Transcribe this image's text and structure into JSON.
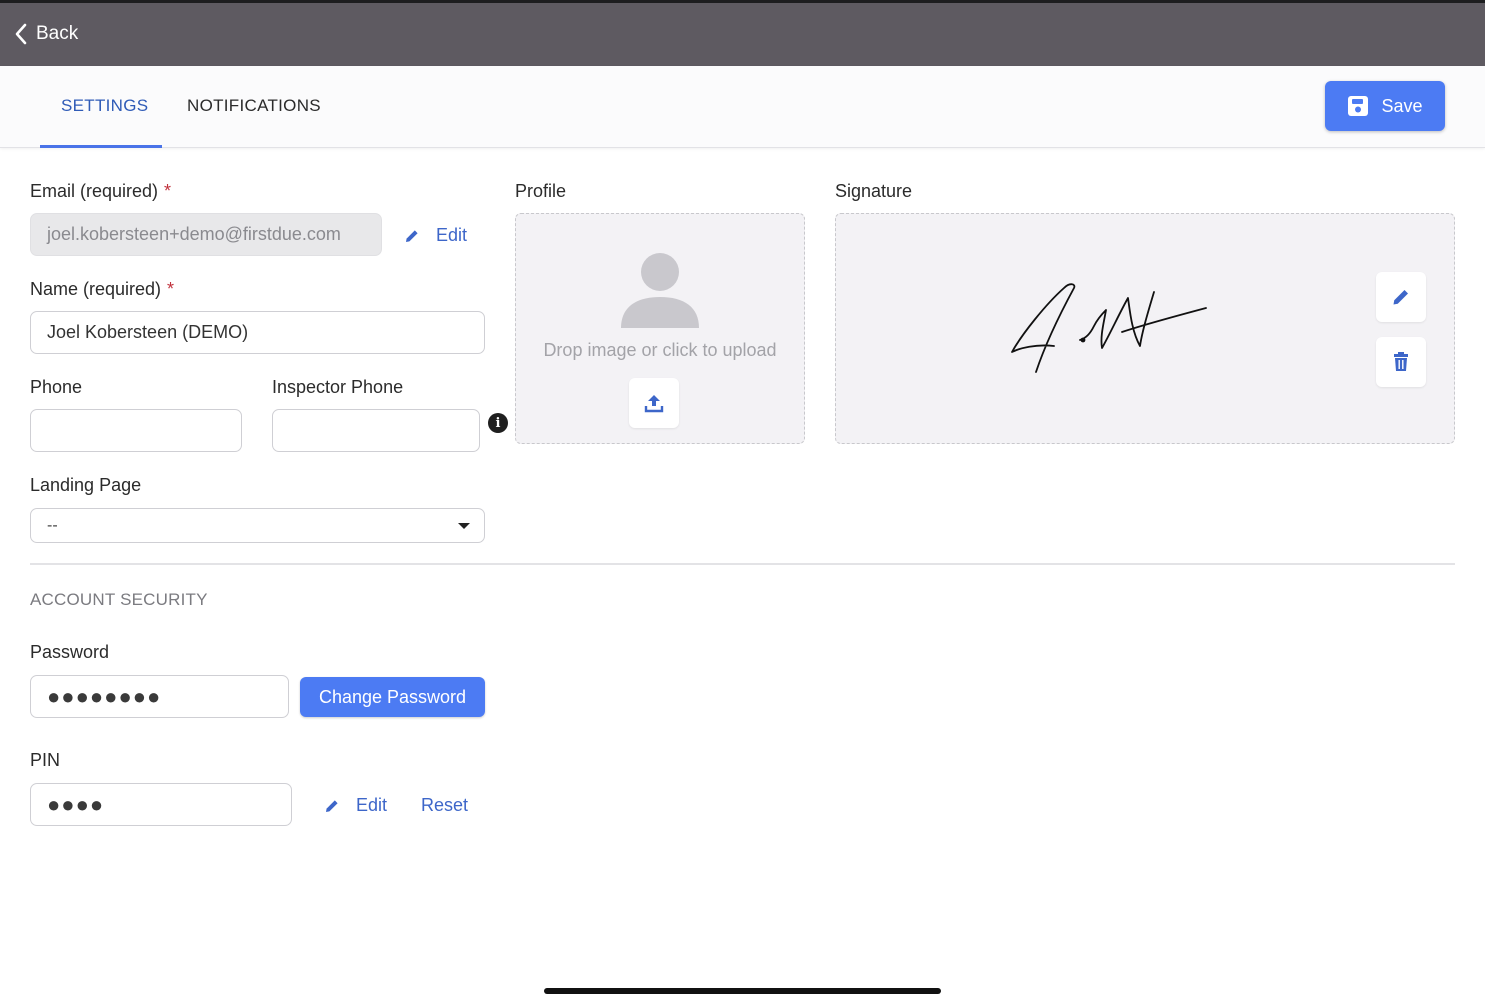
{
  "header": {
    "back_label": "Back"
  },
  "tabs": [
    {
      "label": "SETTINGS",
      "active": true
    },
    {
      "label": "NOTIFICATIONS",
      "active": false
    }
  ],
  "toolbar": {
    "save_label": "Save"
  },
  "colors": {
    "accent": "#4c7bf3",
    "link": "#3d66c9",
    "required": "#c0313c",
    "topbar": "#5e5a61"
  },
  "form": {
    "email": {
      "label": "Email (required)",
      "required_mark": "*",
      "value": "joel.kobersteen+demo@firstdue.com",
      "edit_label": "Edit"
    },
    "name": {
      "label": "Name (required)",
      "required_mark": "*",
      "value": "Joel Kobersteen (DEMO)"
    },
    "phone": {
      "label": "Phone",
      "value": ""
    },
    "inspector_phone": {
      "label": "Inspector Phone",
      "value": "",
      "info_icon": "i"
    },
    "landing_page": {
      "label": "Landing Page",
      "value": "--"
    }
  },
  "profile": {
    "label": "Profile",
    "drop_text": "Drop image or click to upload"
  },
  "signature": {
    "label": "Signature"
  },
  "security": {
    "title": "ACCOUNT SECURITY",
    "password": {
      "label": "Password",
      "value": "●●●●●●●●",
      "change_label": "Change Password"
    },
    "pin": {
      "label": "PIN",
      "value": "●●●●",
      "edit_label": "Edit",
      "reset_label": "Reset"
    }
  }
}
